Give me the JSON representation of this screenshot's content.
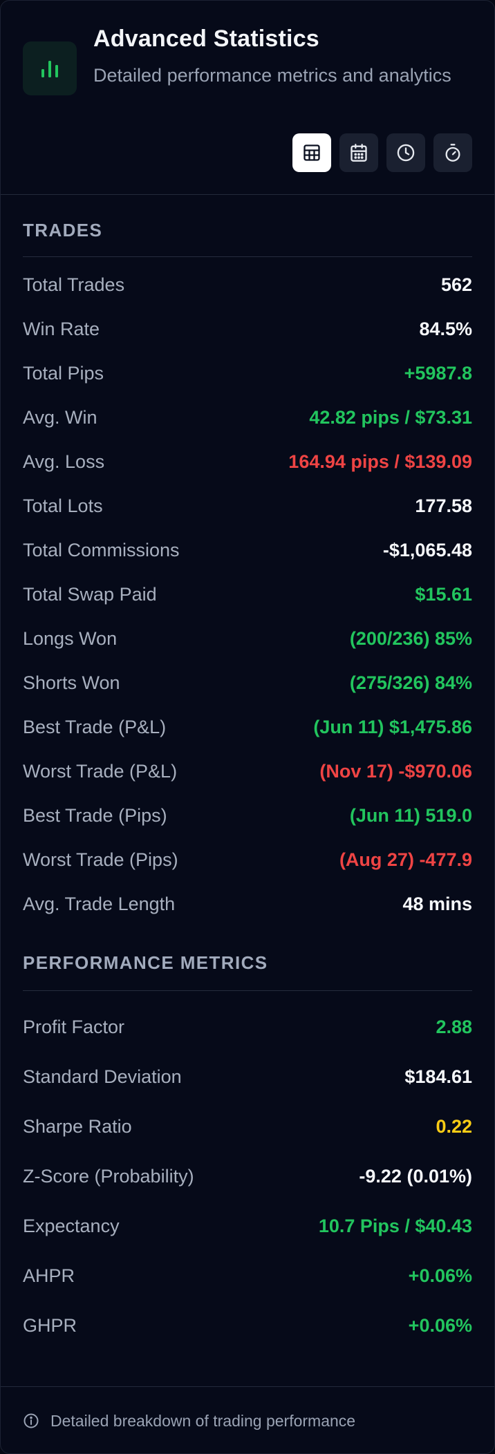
{
  "header": {
    "title": "Advanced Statistics",
    "subtitle": "Detailed performance metrics and analytics",
    "logo_icon": "bar-chart-icon",
    "accent_color": "#22c55e",
    "views": [
      {
        "icon": "table-icon",
        "active": true
      },
      {
        "icon": "calendar-icon",
        "active": false
      },
      {
        "icon": "clock-icon",
        "active": false
      },
      {
        "icon": "stopwatch-icon",
        "active": false
      }
    ]
  },
  "trades": {
    "title": "TRADES",
    "rows": [
      {
        "label": "Total Trades",
        "value": "562",
        "color": "white"
      },
      {
        "label": "Win Rate",
        "value": "84.5%",
        "color": "white"
      },
      {
        "label": "Total Pips",
        "value": "+5987.8",
        "color": "green"
      },
      {
        "label": "Avg. Win",
        "value": "42.82 pips / $73.31",
        "color": "green"
      },
      {
        "label": "Avg. Loss",
        "value": "164.94 pips / $139.09",
        "color": "red"
      },
      {
        "label": "Total Lots",
        "value": "177.58",
        "color": "white"
      },
      {
        "label": "Total Commissions",
        "value": "-$1,065.48",
        "color": "white"
      },
      {
        "label": "Total Swap Paid",
        "value": "$15.61",
        "color": "green"
      },
      {
        "label": "Longs Won",
        "value": "(200/236) 85%",
        "color": "green"
      },
      {
        "label": "Shorts Won",
        "value": "(275/326) 84%",
        "color": "green"
      },
      {
        "label": "Best Trade (P&L)",
        "value": "(Jun 11) $1,475.86",
        "color": "green"
      },
      {
        "label": "Worst Trade (P&L)",
        "value": "(Nov 17) -$970.06",
        "color": "red"
      },
      {
        "label": "Best Trade (Pips)",
        "value": "(Jun 11) 519.0",
        "color": "green"
      },
      {
        "label": "Worst Trade (Pips)",
        "value": "(Aug 27) -477.9",
        "color": "red"
      },
      {
        "label": "Avg. Trade Length",
        "value": "48 mins",
        "color": "white"
      }
    ]
  },
  "performance": {
    "title": "PERFORMANCE METRICS",
    "rows": [
      {
        "label": "Profit Factor",
        "value": "2.88",
        "color": "green"
      },
      {
        "label": "Standard Deviation",
        "value": "$184.61",
        "color": "white"
      },
      {
        "label": "Sharpe Ratio",
        "value": "0.22",
        "color": "yellow"
      },
      {
        "label": "Z-Score (Probability)",
        "value": "-9.22 (0.01%)",
        "color": "white"
      },
      {
        "label": "Expectancy",
        "value": "10.7 Pips / $40.43",
        "color": "green"
      },
      {
        "label": "AHPR",
        "value": "+0.06%",
        "color": "green"
      },
      {
        "label": "GHPR",
        "value": "+0.06%",
        "color": "green"
      }
    ]
  },
  "footer": {
    "icon": "info-icon",
    "text": "Detailed breakdown of trading performance"
  }
}
